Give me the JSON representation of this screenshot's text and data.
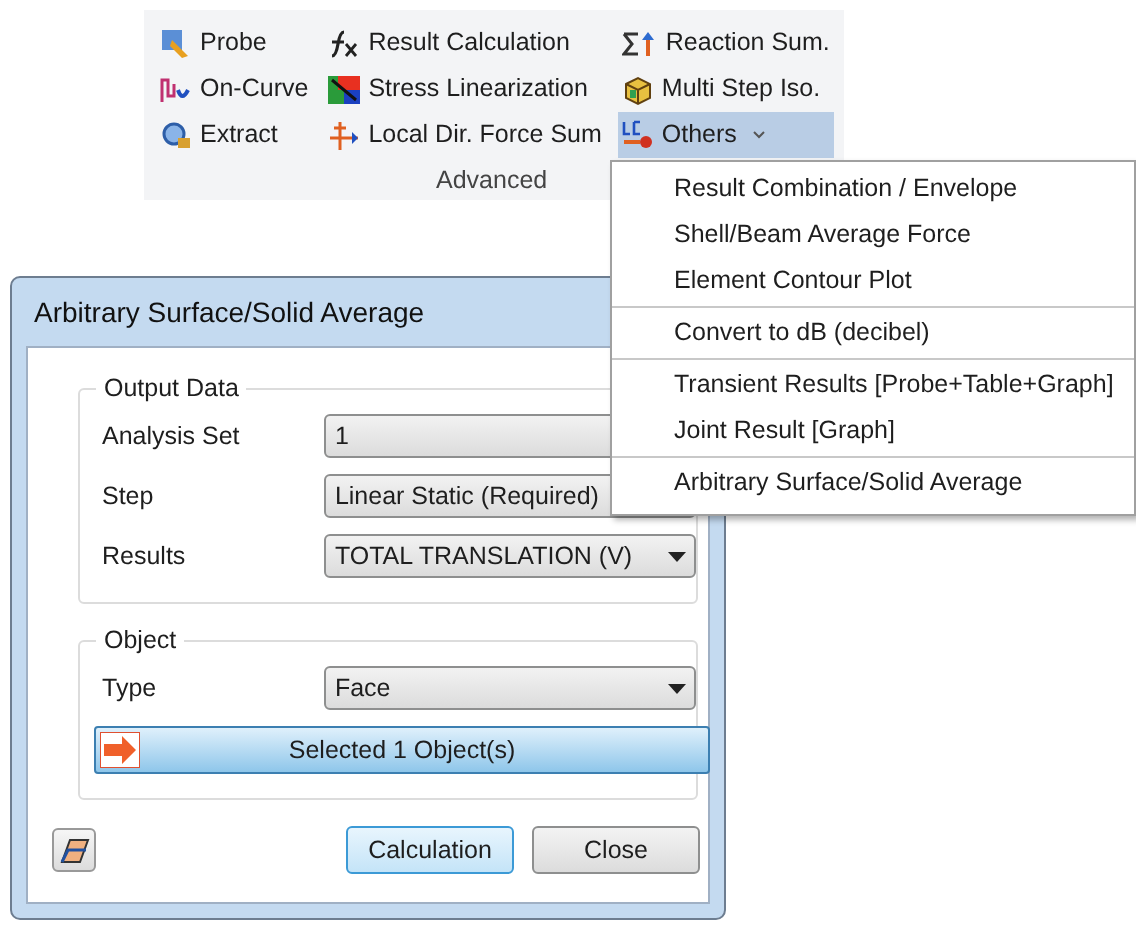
{
  "ribbon": {
    "columns": [
      [
        {
          "label": "Probe",
          "selected": false
        },
        {
          "label": "On-Curve",
          "selected": false
        },
        {
          "label": "Extract",
          "selected": false
        }
      ],
      [
        {
          "label": "Result Calculation",
          "selected": false
        },
        {
          "label": "Stress Linearization",
          "selected": false
        },
        {
          "label": "Local Dir. Force Sum",
          "selected": false
        }
      ],
      [
        {
          "label": "Reaction Sum.",
          "selected": false
        },
        {
          "label": "Multi Step Iso.",
          "selected": false
        },
        {
          "label": "Others",
          "selected": true
        }
      ]
    ],
    "group_label": "Advanced"
  },
  "menu": {
    "groups": [
      [
        "Result Combination / Envelope",
        "Shell/Beam Average Force",
        "Element Contour Plot"
      ],
      [
        "Convert to dB (decibel)"
      ],
      [
        "Transient Results [Probe+Table+Graph]",
        "Joint Result [Graph]"
      ],
      [
        "Arbitrary Surface/Solid Average"
      ]
    ]
  },
  "dialog": {
    "title": "Arbitrary Surface/Solid Average",
    "output_group": {
      "title": "Output Data",
      "fields": [
        {
          "label": "Analysis Set",
          "value": "1"
        },
        {
          "label": "Step",
          "value": "Linear Static (Required)"
        },
        {
          "label": "Results",
          "value": "TOTAL TRANSLATION (V)"
        }
      ]
    },
    "object_group": {
      "title": "Object",
      "fields": [
        {
          "label": "Type",
          "value": "Face"
        }
      ],
      "select_button": "Selected 1 Object(s)"
    },
    "buttons": [
      {
        "label": "Calculation",
        "selected": true
      },
      {
        "label": "Close",
        "selected": false
      }
    ]
  }
}
